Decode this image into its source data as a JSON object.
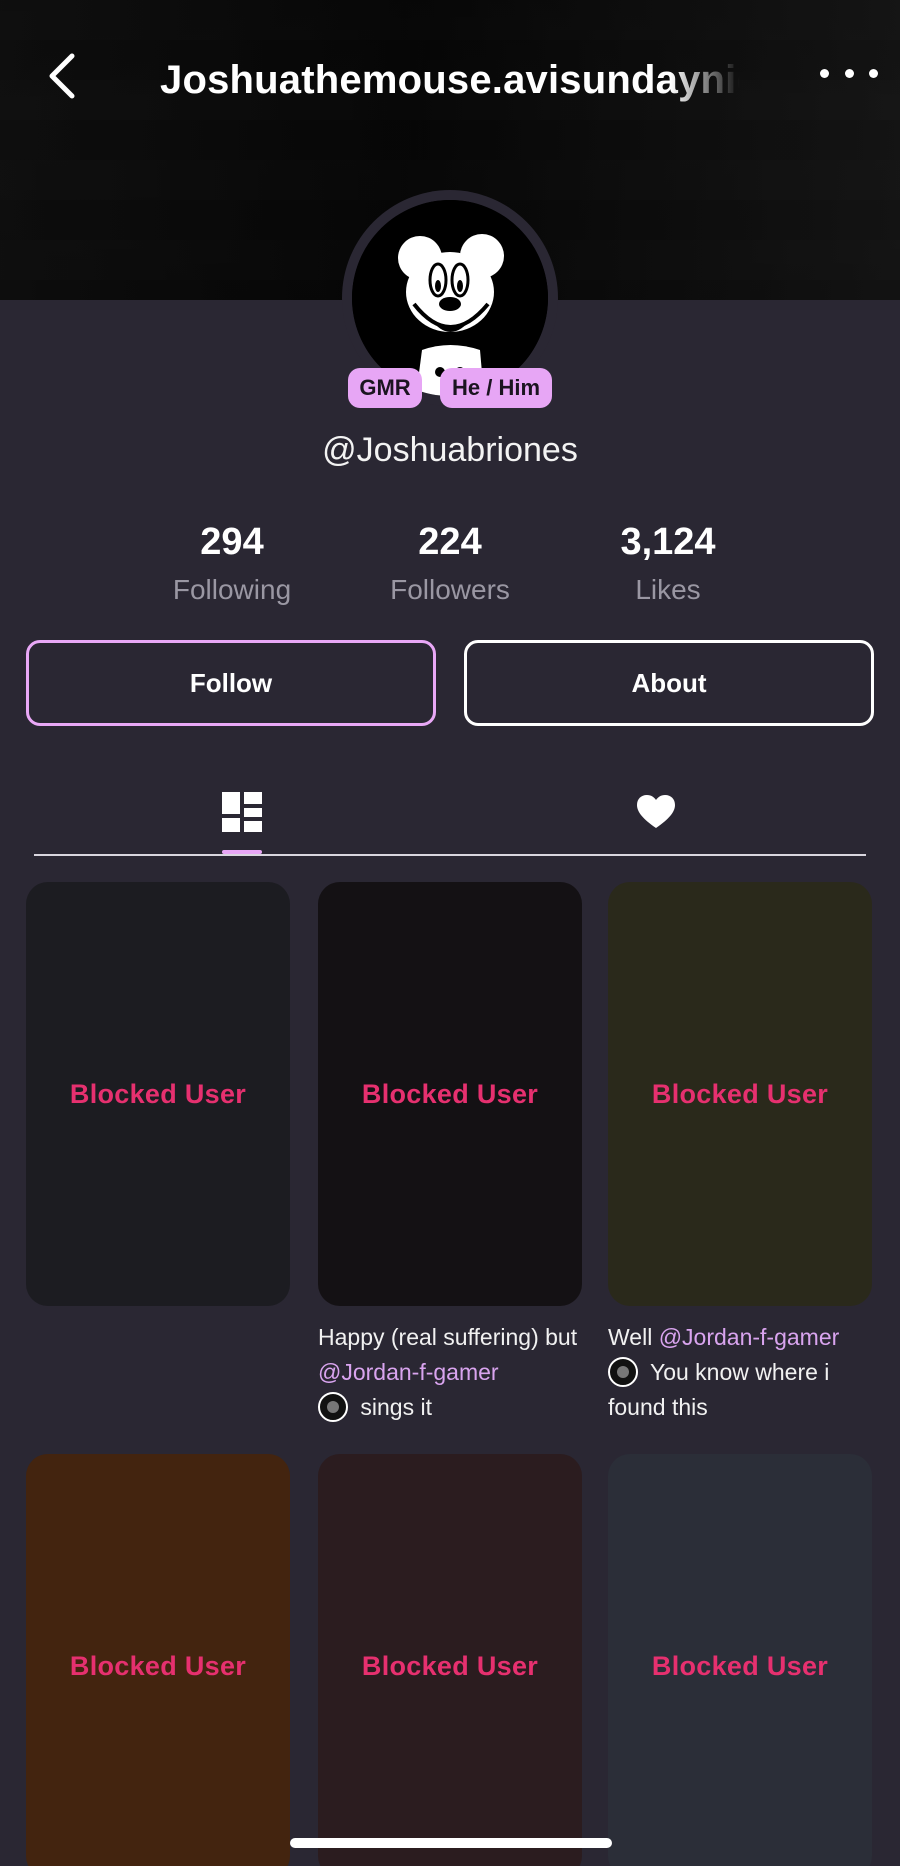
{
  "header": {
    "title": "Joshuathemouse.avisundaynight",
    "back_icon": "chevron-left-icon",
    "more_icon": "more-horizontal-icon"
  },
  "profile": {
    "badges": [
      "GMR",
      "He / Him"
    ],
    "handle": "@Joshuabriones",
    "avatar_icon": "cartoon-mouse-avatar"
  },
  "stats": [
    {
      "value": "294",
      "label": "Following"
    },
    {
      "value": "224",
      "label": "Followers"
    },
    {
      "value": "3,124",
      "label": "Likes"
    }
  ],
  "actions": {
    "follow_label": "Follow",
    "about_label": "About"
  },
  "tabs": [
    {
      "icon": "grid-icon",
      "active": true
    },
    {
      "icon": "heart-icon",
      "active": false
    }
  ],
  "videos": [
    {
      "label": "Blocked User",
      "bg": "#1c1c21"
    },
    {
      "label": "Blocked User",
      "bg": "#141114",
      "caption": {
        "pre": "Happy (real suffering) but ",
        "mention": "@Jordan-f-gamer",
        "post": " sings it"
      }
    },
    {
      "label": "Blocked User",
      "bg": "#2a291b",
      "caption": {
        "pre": "Well ",
        "mention": "@Jordan-f-gamer",
        "post": " You know where i found this"
      }
    },
    {
      "label": "Blocked User",
      "bg": "#43240f"
    },
    {
      "label": "Blocked User",
      "bg": "#2b1c1f"
    },
    {
      "label": "Blocked User",
      "bg": "#2b2e38"
    }
  ],
  "colors": {
    "accent": "#e7a6f5",
    "blocked_text": "#e6306f",
    "background": "#2a2733"
  }
}
